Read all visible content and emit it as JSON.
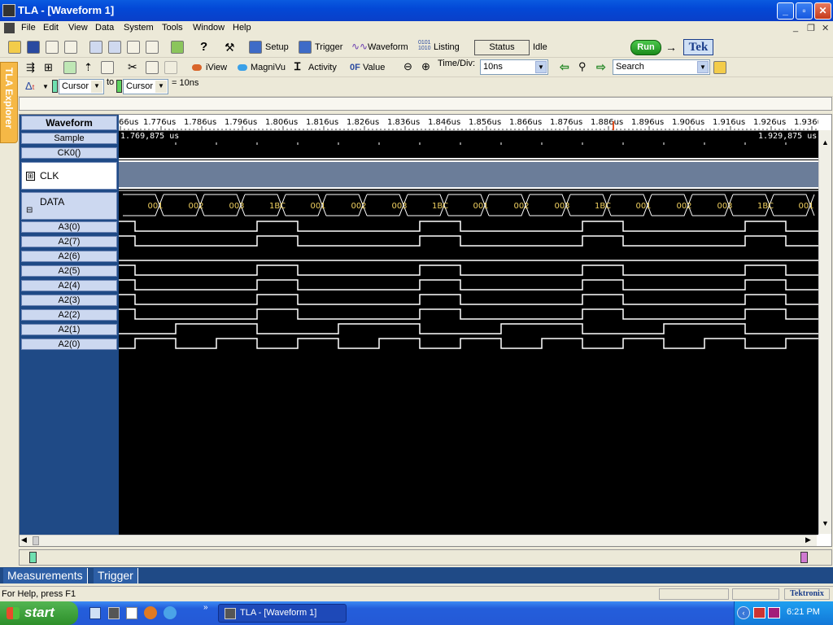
{
  "window": {
    "title": "TLA - [Waveform 1]"
  },
  "menu": [
    "File",
    "Edit",
    "View",
    "Data",
    "System",
    "Tools",
    "Window",
    "Help"
  ],
  "toolbar1": {
    "setup": "Setup",
    "trigger": "Trigger",
    "waveform": "Waveform",
    "listing": "Listing",
    "status_label": "Status",
    "status_value": "Idle",
    "run": "Run",
    "brand": "Tek"
  },
  "toolbar2": {
    "iview": "iView",
    "magnivu": "MagniVu",
    "activity": "Activity",
    "value": "Value",
    "timediv_label": "Time/Div:",
    "timediv_value": "10ns",
    "search_value": "Search"
  },
  "toolbar3": {
    "cursor1": "Cursor 1",
    "to": "to",
    "cursor2": "Cursor 2",
    "delta": "= 10ns"
  },
  "explorer": "TLA Explorer",
  "waveform": {
    "header": "Waveform",
    "timescale": [
      "66us",
      "1.776us",
      "1.786us",
      "1.796us",
      "1.806us",
      "1.816us",
      "1.826us",
      "1.836us",
      "1.846us",
      "1.856us",
      "1.866us",
      "1.876us",
      "1.886us",
      "1.896us",
      "1.906us",
      "1.916us",
      "1.926us",
      "1.936us"
    ],
    "sample_start": "1.769,875 us",
    "sample_end": "1.929,875 us",
    "signals": [
      "Sample",
      "CK0()",
      "CLK",
      "DATA",
      "A3(0)",
      "A2(7)",
      "A2(6)",
      "A2(5)",
      "A2(4)",
      "A2(3)",
      "A2(2)",
      "A2(1)",
      "A2(0)"
    ],
    "data_values": [
      "001",
      "002",
      "003",
      "1BC",
      "001",
      "002",
      "003",
      "1BC",
      "001",
      "002",
      "003",
      "1BC",
      "001",
      "002",
      "003",
      "1BC",
      "001"
    ]
  },
  "tabs": [
    "Measurements",
    "Trigger"
  ],
  "status": {
    "help": "For Help, press F1",
    "brand": "Tektronix"
  },
  "taskbar": {
    "start": "start",
    "task": "TLA - [Waveform 1]",
    "clock": "6:21 PM"
  },
  "colors": {
    "plot_bg": "#000000",
    "trace": "#ffffff",
    "data_text": "#f0d060",
    "clk_fill": "#6b7d99",
    "label_bg": "#ccd8f0",
    "panel": "#1f4a86"
  }
}
